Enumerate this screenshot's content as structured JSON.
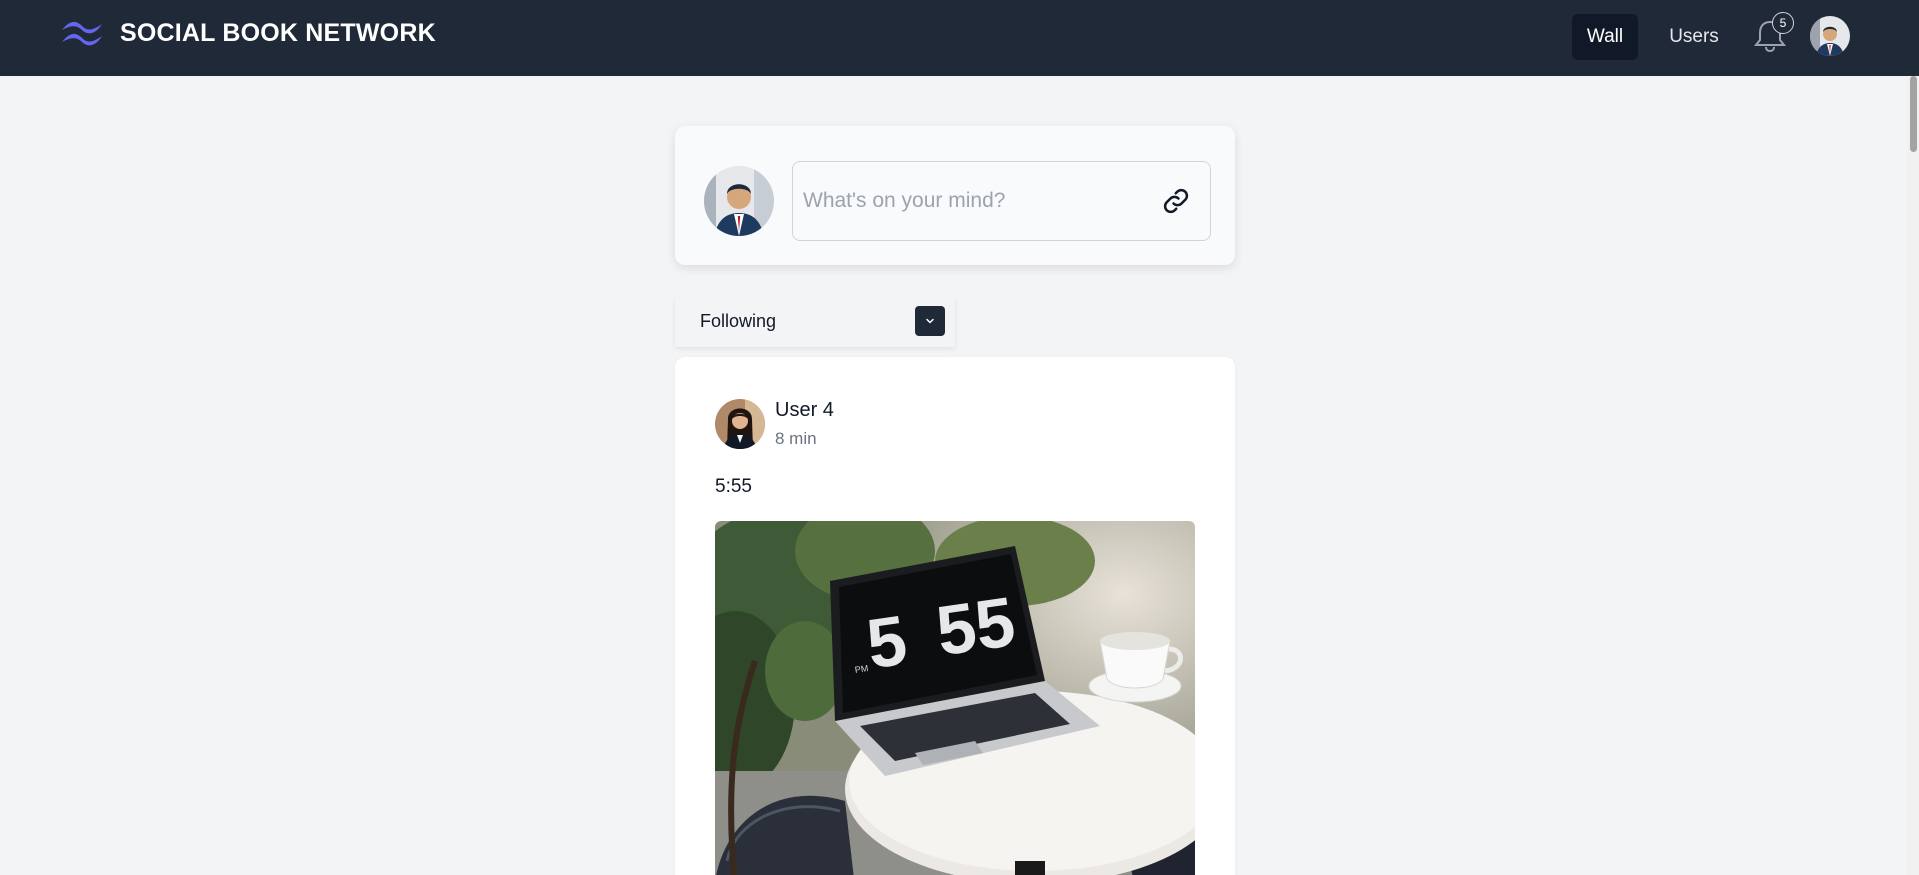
{
  "header": {
    "brand": "SOCIAL BOOK NETWORK",
    "nav": {
      "wall": "Wall",
      "users": "Users"
    },
    "notifications_count": "5",
    "logo_icon": "tailwind-wave-logo",
    "bell_icon": "bell-icon"
  },
  "composer": {
    "placeholder": "What's on your mind?",
    "attach_icon": "link-icon"
  },
  "filter": {
    "selected": "Following",
    "toggle_icon": "chevron-down-icon"
  },
  "post": {
    "author": "User 4",
    "time": "8 min",
    "text": "5:55",
    "image": {
      "clock_hour": "5",
      "clock_minutes": "55",
      "clock_period": "PM"
    }
  },
  "colors": {
    "navbar": "#1f2937",
    "background": "#f3f4f6",
    "logo": "#6366f1"
  }
}
